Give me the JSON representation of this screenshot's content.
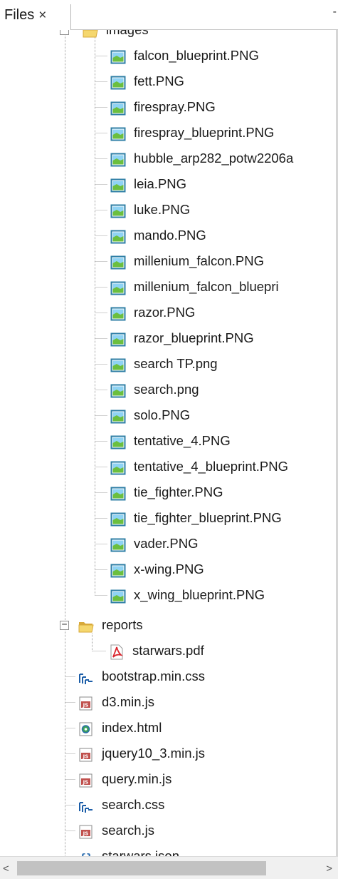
{
  "tab": {
    "title": "Files",
    "close_glyph": "×",
    "right_marker": "-"
  },
  "images_folder": {
    "label": "images",
    "icon": "folder-open-icon",
    "toggle": "−"
  },
  "images": [
    {
      "name": "falcon_blueprint.PNG",
      "icon": "image-file-icon"
    },
    {
      "name": "fett.PNG",
      "icon": "image-file-icon"
    },
    {
      "name": "firespray.PNG",
      "icon": "image-file-icon"
    },
    {
      "name": "firespray_blueprint.PNG",
      "icon": "image-file-icon"
    },
    {
      "name": "hubble_arp282_potw2206a",
      "icon": "image-file-icon"
    },
    {
      "name": "leia.PNG",
      "icon": "image-file-icon"
    },
    {
      "name": "luke.PNG",
      "icon": "image-file-icon"
    },
    {
      "name": "mando.PNG",
      "icon": "image-file-icon"
    },
    {
      "name": "millenium_falcon.PNG",
      "icon": "image-file-icon"
    },
    {
      "name": "millenium_falcon_bluepri",
      "icon": "image-file-icon"
    },
    {
      "name": "razor.PNG",
      "icon": "image-file-icon"
    },
    {
      "name": "razor_blueprint.PNG",
      "icon": "image-file-icon"
    },
    {
      "name": "search TP.png",
      "icon": "image-file-icon"
    },
    {
      "name": "search.png",
      "icon": "image-file-icon"
    },
    {
      "name": "solo.PNG",
      "icon": "image-file-icon"
    },
    {
      "name": "tentative_4.PNG",
      "icon": "image-file-icon"
    },
    {
      "name": "tentative_4_blueprint.PNG",
      "icon": "image-file-icon"
    },
    {
      "name": "tie_fighter.PNG",
      "icon": "image-file-icon"
    },
    {
      "name": "tie_fighter_blueprint.PNG",
      "icon": "image-file-icon"
    },
    {
      "name": "vader.PNG",
      "icon": "image-file-icon"
    },
    {
      "name": "x-wing.PNG",
      "icon": "image-file-icon"
    },
    {
      "name": "x_wing_blueprint.PNG",
      "icon": "image-file-icon"
    }
  ],
  "reports_folder": {
    "label": "reports",
    "icon": "folder-open-icon",
    "toggle": "−"
  },
  "reports": [
    {
      "name": "starwars.pdf",
      "icon": "pdf-file-icon"
    }
  ],
  "root_files": [
    {
      "name": "bootstrap.min.css",
      "icon": "css-file-icon"
    },
    {
      "name": "d3.min.js",
      "icon": "js-file-icon"
    },
    {
      "name": "index.html",
      "icon": "html-file-icon"
    },
    {
      "name": "jquery10_3.min.js",
      "icon": "js-file-icon"
    },
    {
      "name": "query.min.js",
      "icon": "js-file-icon"
    },
    {
      "name": "search.css",
      "icon": "css-file-icon"
    },
    {
      "name": "search.js",
      "icon": "js-file-icon"
    },
    {
      "name": "starwars.json",
      "icon": "json-file-icon"
    }
  ],
  "colors": {
    "folder": "#f5d76e",
    "folder_edge": "#d8a93a",
    "image_frame": "#2f7fa6",
    "image_sky": "#8fd3f4",
    "image_grass": "#6bbf3f",
    "pdf_red": "#d9262e",
    "js_fill": "#c0504d",
    "css_blue": "#1c5ea8",
    "tree_line": "#a0a0a0"
  },
  "scrollbar": {
    "left_arrow": "<",
    "right_arrow": ">"
  }
}
